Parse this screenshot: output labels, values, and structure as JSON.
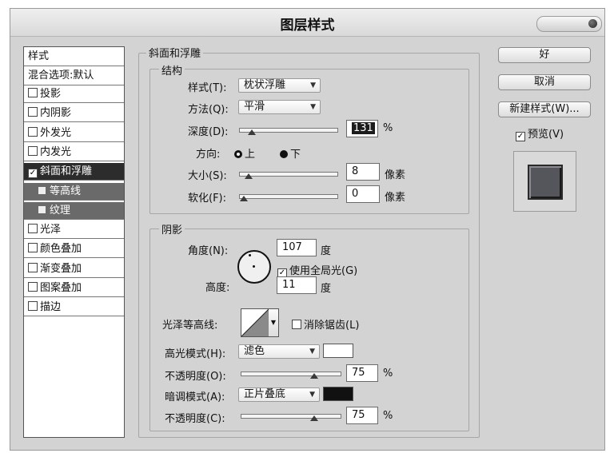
{
  "window": {
    "title": "图层样式"
  },
  "styles_list": {
    "header": "样式",
    "blend_options": "混合选项:默认",
    "items": [
      {
        "label": "投影",
        "checked": false
      },
      {
        "label": "内阴影",
        "checked": false
      },
      {
        "label": "外发光",
        "checked": false
      },
      {
        "label": "内发光",
        "checked": false
      },
      {
        "label": "斜面和浮雕",
        "checked": true,
        "selected": true
      },
      {
        "label": "等高线",
        "sub": true
      },
      {
        "label": "纹理",
        "sub": true
      },
      {
        "label": "光泽",
        "checked": false
      },
      {
        "label": "颜色叠加",
        "checked": false
      },
      {
        "label": "渐变叠加",
        "checked": false
      },
      {
        "label": "图案叠加",
        "checked": false
      },
      {
        "label": "描边",
        "checked": false
      }
    ]
  },
  "bevel": {
    "group_title": "斜面和浮雕",
    "structure": {
      "title": "结构",
      "style_label": "样式(T):",
      "style_value": "枕状浮雕",
      "technique_label": "方法(Q):",
      "technique_value": "平滑",
      "depth_label": "深度(D):",
      "depth_value": "131",
      "depth_unit": "%",
      "depth_level": 0.09,
      "direction_label": "方向:",
      "direction_up": "上",
      "direction_down": "下",
      "direction_selected": "上",
      "size_label": "大小(S):",
      "size_value": "8",
      "size_unit": "像素",
      "size_level": 0.05,
      "soften_label": "软化(F):",
      "soften_value": "0",
      "soften_unit": "像素",
      "soften_level": 0.0
    },
    "shading": {
      "title": "阴影",
      "angle_label": "角度(N):",
      "angle_value": "107",
      "angle_unit": "度",
      "global_light_label": "使用全局光(G)",
      "global_light_checked": true,
      "altitude_label": "高度:",
      "altitude_value": "11",
      "altitude_unit": "度",
      "gloss_contour_label": "光泽等高线:",
      "antialias_label": "消除锯齿(L)",
      "antialias_checked": false,
      "highlight_mode_label": "高光模式(H):",
      "highlight_mode_value": "滤色",
      "highlight_color": "#ffffff",
      "highlight_opacity_label": "不透明度(O):",
      "highlight_opacity_value": "75",
      "highlight_opacity_unit": "%",
      "highlight_opacity_level": 0.75,
      "shadow_mode_label": "暗调模式(A):",
      "shadow_mode_value": "正片叠底",
      "shadow_color": "#111111",
      "shadow_opacity_label": "不透明度(C):",
      "shadow_opacity_value": "75",
      "shadow_opacity_unit": "%",
      "shadow_opacity_level": 0.75
    }
  },
  "buttons": {
    "ok": "好",
    "cancel": "取消",
    "new_style": "新建样式(W)...",
    "preview_label": "预览(V)",
    "preview_checked": true
  }
}
